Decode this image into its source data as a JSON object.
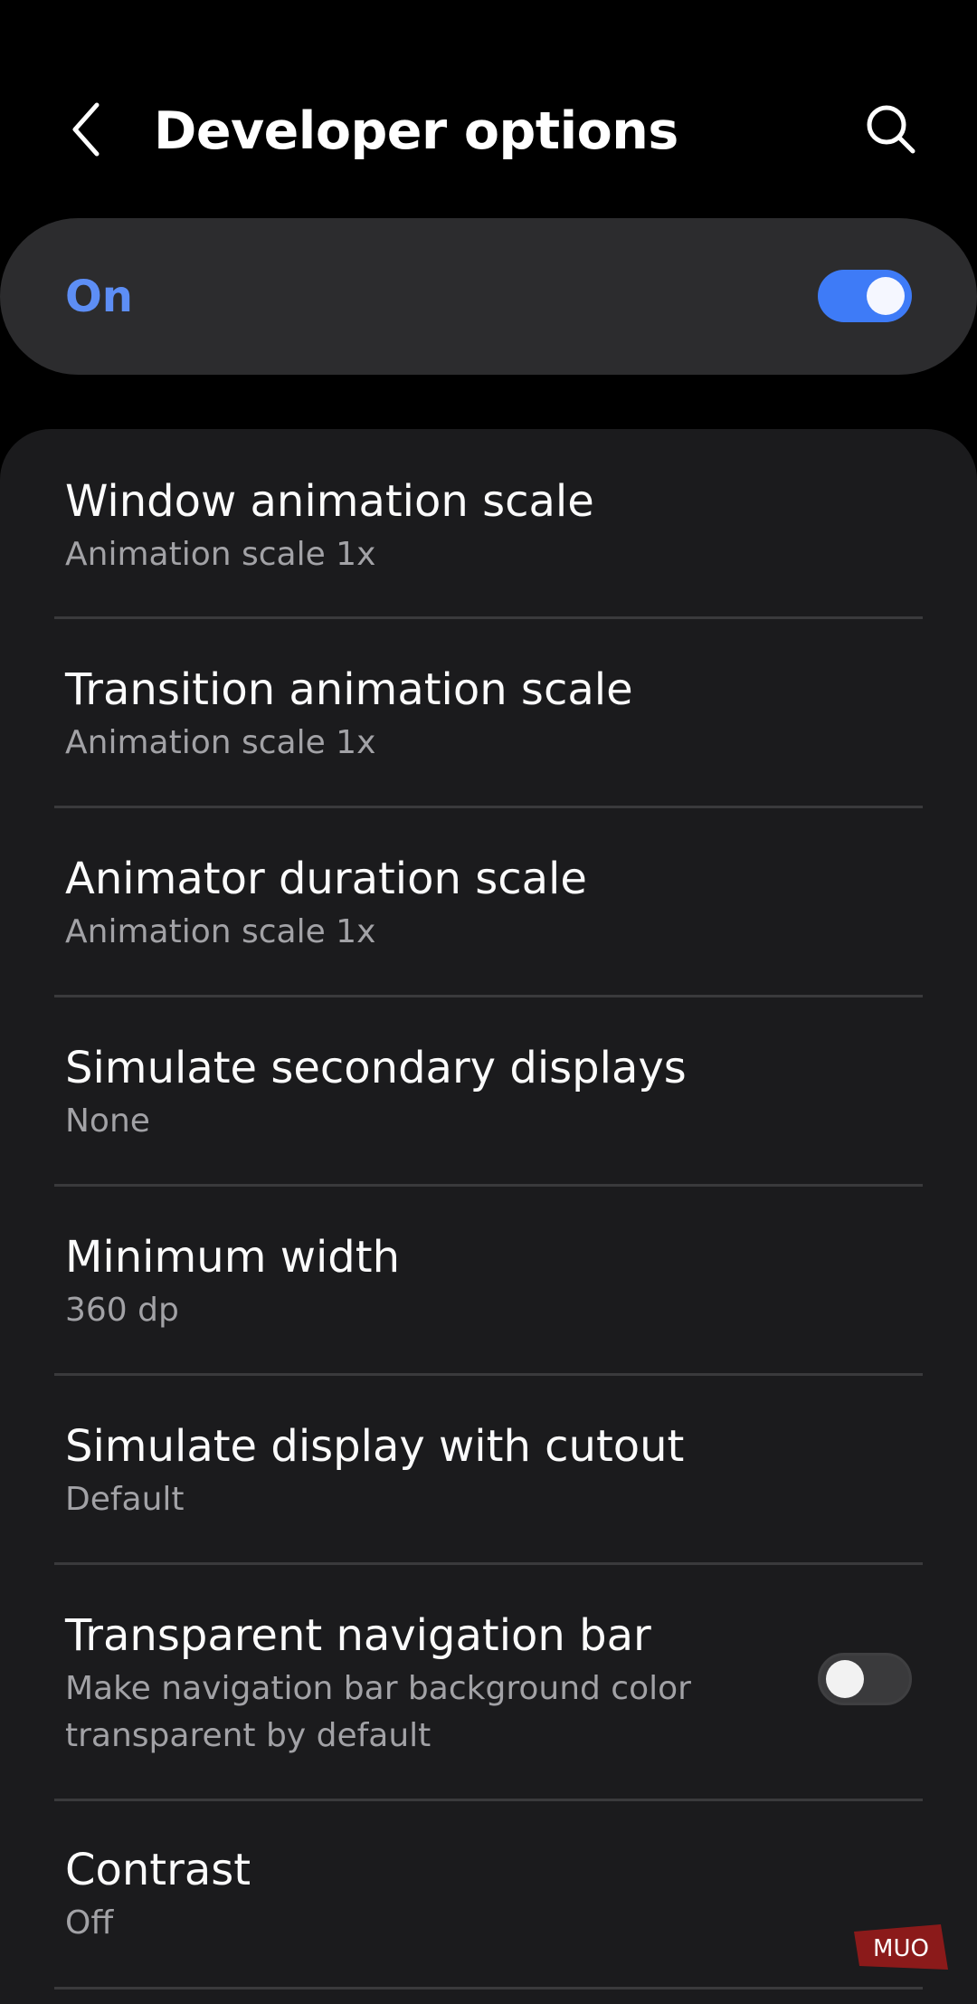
{
  "header": {
    "title": "Developer options",
    "back_icon": "chevron-left-icon",
    "search_icon": "search-icon"
  },
  "master_switch": {
    "label": "On",
    "state": "on",
    "accent": "#3e7bf7"
  },
  "settings": [
    {
      "title": "Window animation scale",
      "subtitle": "Animation scale 1x"
    },
    {
      "title": "Transition animation scale",
      "subtitle": "Animation scale 1x"
    },
    {
      "title": "Animator duration scale",
      "subtitle": "Animation scale 1x"
    },
    {
      "title": "Simulate secondary displays",
      "subtitle": "None"
    },
    {
      "title": "Minimum width",
      "subtitle": "360 dp"
    },
    {
      "title": "Simulate display with cutout",
      "subtitle": "Default"
    },
    {
      "title": "Transparent navigation bar",
      "subtitle_line1": "Make navigation bar background color",
      "subtitle_line2": "transparent by default",
      "toggle": "off"
    },
    {
      "title": "Contrast",
      "subtitle": "Off"
    }
  ],
  "watermark": {
    "text": "MUO",
    "color": "#8b1a1a"
  }
}
